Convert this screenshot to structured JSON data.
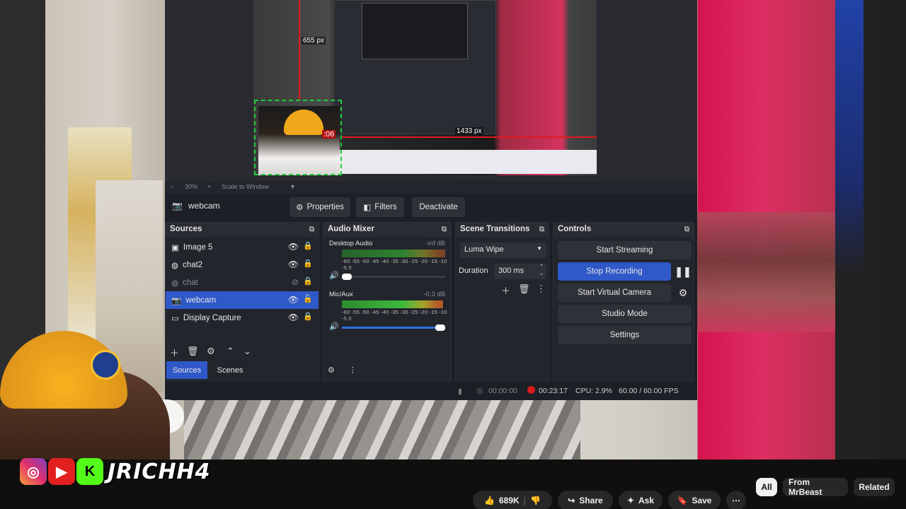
{
  "obs": {
    "preview": {
      "height_label": "655 px",
      "width_label": "1433 px",
      "overlay_tag": ":06",
      "zoom": "30%",
      "zoom_mode": "Scale to Window"
    },
    "selected_source": "webcam",
    "toolbar": {
      "properties": "Properties",
      "filters": "Filters",
      "deactivate": "Deactivate"
    },
    "sources": {
      "title": "Sources",
      "items": [
        {
          "label": "Image 5",
          "icon": "image-icon",
          "visible": true,
          "selected": false
        },
        {
          "label": "chat2",
          "icon": "browser-icon",
          "visible": true,
          "selected": false
        },
        {
          "label": "chat",
          "icon": "browser-icon",
          "visible": false,
          "selected": false
        },
        {
          "label": "webcam",
          "icon": "camera-icon",
          "visible": true,
          "selected": true
        },
        {
          "label": "Display Capture",
          "icon": "monitor-icon",
          "visible": true,
          "selected": false
        }
      ]
    },
    "tabs": {
      "sources": "Sources",
      "scenes": "Scenes"
    },
    "audio_mixer": {
      "title": "Audio Mixer",
      "channels": [
        {
          "name": "Desktop Audio",
          "db": "-inf dB",
          "level_fraction": 1.0,
          "volume_fraction": 0.05
        },
        {
          "name": "Mic/Aux",
          "db": "-0.3 dB",
          "level_fraction": 0.98,
          "volume_fraction": 0.96
        }
      ],
      "scale": "-60 -55 -50 -45 -40 -35 -30 -25 -20 -15 -10 -5 0"
    },
    "scene_transitions": {
      "title": "Scene Transitions",
      "transition": "Luma Wipe",
      "duration_label": "Duration",
      "duration_value": "300 ms"
    },
    "controls": {
      "title": "Controls",
      "start_streaming": "Start Streaming",
      "stop_recording": "Stop Recording",
      "start_virtual_camera": "Start Virtual Camera",
      "studio_mode": "Studio Mode",
      "settings": "Settings"
    },
    "status": {
      "stream_time": "00:00:00",
      "record_time": "00:23:17",
      "cpu": "CPU: 2.9%",
      "fps": "60.00 / 60.00 FPS"
    }
  },
  "overlay": {
    "timer": ":06",
    "handle": "JRICHH4",
    "socials": [
      "instagram-icon",
      "youtube-icon",
      "kick-icon"
    ],
    "kick_letter": "K"
  },
  "youtube": {
    "likes": "689K",
    "share": "Share",
    "ask": "Ask",
    "save": "Save",
    "chips": [
      "All",
      "From MrBeast",
      "Related"
    ]
  },
  "colors": {
    "obs_accent": "#2f58c8",
    "record_red": "#d81b1b",
    "youtube_bg": "#0f0f0f"
  }
}
